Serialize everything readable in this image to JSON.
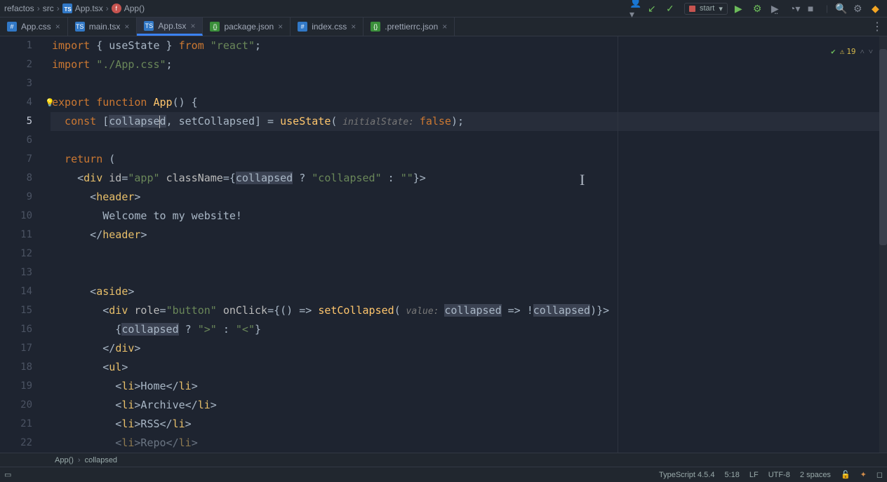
{
  "breadcrumbs": {
    "root": "refactos",
    "folder": "src",
    "file": "App.tsx",
    "symbol": "App()"
  },
  "run_config": "start",
  "tabs": [
    {
      "label": "App.css",
      "icon": "css"
    },
    {
      "label": "main.tsx",
      "icon": "tsx"
    },
    {
      "label": "App.tsx",
      "icon": "tsx",
      "active": true
    },
    {
      "label": "package.json",
      "icon": "json"
    },
    {
      "label": "index.css",
      "icon": "css"
    },
    {
      "label": ".prettierrc.json",
      "icon": "json"
    }
  ],
  "inspection_count": "19",
  "code": {
    "l1a": "import",
    "l1b": " { ",
    "l1c": "useState",
    "l1d": " } ",
    "l1e": "from ",
    "l1f": "\"react\"",
    "l1g": ";",
    "l2a": "import ",
    "l2b": "\"./App.css\"",
    "l2c": ";",
    "l4a": "export function ",
    "l4b": "App",
    "l4c": "() {",
    "l5a": "  const ",
    "l5b": "[",
    "l5c": "collapse",
    "l5d": "d",
    "l5e": ", ",
    "l5f": "setCollapsed",
    "l5g": "] = ",
    "l5h": "useState",
    "l5i": "(",
    "l5hint": " initialState: ",
    "l5j": "false",
    "l5k": ");",
    "l7a": "  return ",
    "l7b": "(",
    "l8a": "    <",
    "l8b": "div ",
    "l8c": "id",
    "l8d": "=",
    "l8e": "\"app\" ",
    "l8f": "className",
    "l8g": "={",
    "l8h": "collapsed",
    "l8i": " ? ",
    "l8j": "\"collapsed\"",
    "l8k": " : ",
    "l8l": "\"\"",
    "l8m": "}>",
    "l9a": "      <",
    "l9b": "header",
    "l9c": ">",
    "l10a": "        Welcome to my website!",
    "l11a": "      </",
    "l11b": "header",
    "l11c": ">",
    "l14a": "      <",
    "l14b": "aside",
    "l14c": ">",
    "l15a": "        <",
    "l15b": "div ",
    "l15c": "role",
    "l15d": "=",
    "l15e": "\"button\" ",
    "l15f": "onClick",
    "l15g": "={() => ",
    "l15h": "setCollapsed",
    "l15i": "(",
    "l15hint": " value: ",
    "l15j": "collapsed",
    "l15k": " => !",
    "l15l": "collapsed",
    "l15m": ")}>",
    "l16a": "          {",
    "l16b": "collapsed",
    "l16c": " ? ",
    "l16d": "\">\"",
    "l16e": " : ",
    "l16f": "\"<\"",
    "l16g": "}",
    "l17a": "        </",
    "l17b": "div",
    "l17c": ">",
    "l18a": "        <",
    "l18b": "ul",
    "l18c": ">",
    "l19a": "          <",
    "l19b": "li",
    "l19c": ">Home</",
    "l19d": "li",
    "l19e": ">",
    "l20a": "          <",
    "l20b": "li",
    "l20c": ">Archive</",
    "l20d": "li",
    "l20e": ">",
    "l21a": "          <",
    "l21b": "li",
    "l21c": ">RSS</",
    "l21d": "li",
    "l21e": ">",
    "l22a": "          <",
    "l22b": "li",
    "l22c": ">Repo</",
    "l22d": "li",
    "l22e": ">"
  },
  "lines": [
    "1",
    "2",
    "3",
    "4",
    "5",
    "6",
    "7",
    "8",
    "9",
    "10",
    "11",
    "12",
    "13",
    "14",
    "15",
    "16",
    "17",
    "18",
    "19",
    "20",
    "21",
    "22"
  ],
  "cursor_line_index": 4,
  "bottom_bc": {
    "a": "App()",
    "b": "collapsed"
  },
  "status": {
    "lang": "TypeScript 4.5.4",
    "pos": "5:18",
    "eol": "LF",
    "enc": "UTF-8",
    "indent": "2 spaces"
  }
}
